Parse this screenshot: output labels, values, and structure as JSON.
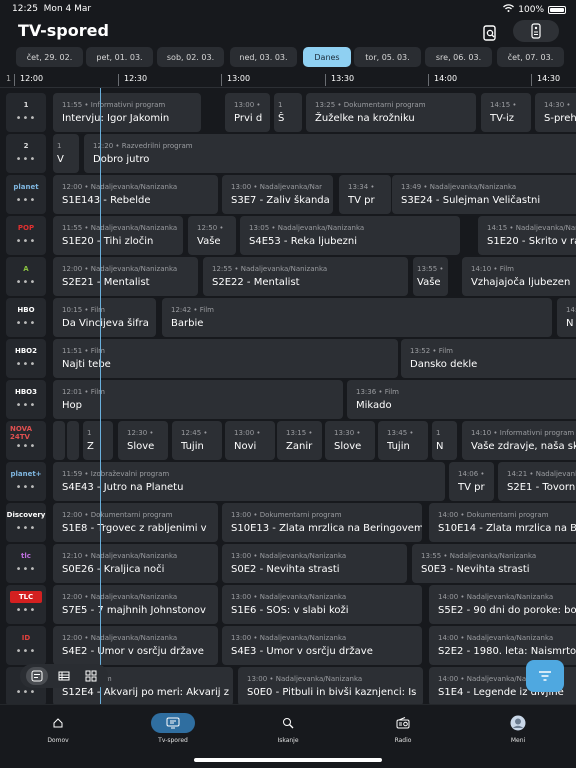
{
  "status": {
    "time": "12:25",
    "date": "Mon 4 Mar",
    "battery": "100%"
  },
  "header": {
    "title": "TV-spored"
  },
  "days": [
    {
      "label": "čet, 29. 02."
    },
    {
      "label": "pet, 01. 03."
    },
    {
      "label": "sob, 02. 03."
    },
    {
      "label": "ned, 03. 03."
    },
    {
      "label": "Danes",
      "active": true
    },
    {
      "label": "tor, 05. 03."
    },
    {
      "label": "sre, 06. 03."
    },
    {
      "label": "čet, 07. 03."
    }
  ],
  "timeline": {
    "lead": "1",
    "ticks": [
      "12:00",
      "12:30",
      "13:00",
      "13:30",
      "14:00",
      "14:30"
    ]
  },
  "channels": [
    {
      "logo": "1",
      "programs": [
        {
          "meta": "11:55 • Informativni program",
          "name": "Intervju: Igor Jakomin"
        },
        {
          "meta": "13:00 •",
          "name": "Prvi d"
        },
        {
          "meta": "1",
          "name": "Š"
        },
        {
          "meta": "13:25 • Dokumentarni program",
          "name": "Žuželke na krožniku"
        },
        {
          "meta": "14:15 •",
          "name": "TV-iz"
        },
        {
          "meta": "14:30 •",
          "name": "S-prehi"
        }
      ]
    },
    {
      "logo": "2",
      "programs": [
        {
          "meta": "1",
          "name": "V"
        },
        {
          "meta": "12:20 • Razvedrilni program",
          "name": "Dobro jutro"
        }
      ]
    },
    {
      "logo": "planet",
      "programs": [
        {
          "meta": "12:00 • Nadaljevanka/Nanizanka",
          "name": "S1E143 - Rebelde"
        },
        {
          "meta": "13:00 • Nadaljevanka/Nar",
          "name": "S3E7 - Zaliv škanda"
        },
        {
          "meta": "13:34 •",
          "name": "TV pr"
        },
        {
          "meta": "13:49 • Nadaljevanka/Nanizanka",
          "name": "S3E24 - Sulejman Veličastni"
        }
      ]
    },
    {
      "logo": "POP",
      "programs": [
        {
          "meta": "11:55 • Nadaljevanka/Nanizanka",
          "name": "S1E20 - Tihi zločin"
        },
        {
          "meta": "12:50 •",
          "name": "Vaše"
        },
        {
          "meta": "13:05 • Nadaljevanka/Nanizanka",
          "name": "S4E53 - Reka ljubezni"
        },
        {
          "meta": "14:15 • Nadaljevanka/Nanizanka",
          "name": "S1E20 - Skrito v ra"
        }
      ]
    },
    {
      "logo": "A",
      "programs": [
        {
          "meta": "12:00 • Nadaljevanka/Nanizanka",
          "name": "S2E21 - Mentalist"
        },
        {
          "meta": "12:55 • Nadaljevanka/Nanizanka",
          "name": "S2E22 - Mentalist"
        },
        {
          "meta": "13:55 •",
          "name": "Vaše"
        },
        {
          "meta": "14:10 • Film",
          "name": "Vzhajajoča ljubezen"
        }
      ]
    },
    {
      "logo": "HBO",
      "programs": [
        {
          "meta": "10:15 • Film",
          "name": "Da Vincijeva šifra"
        },
        {
          "meta": "12:42 • Film",
          "name": "Barbie"
        },
        {
          "meta": "14:",
          "name": "N"
        }
      ]
    },
    {
      "logo": "HBO2",
      "programs": [
        {
          "meta": "11:51 • Film",
          "name": "Najti tebe"
        },
        {
          "meta": "13:52 • Film",
          "name": "Dansko dekle"
        }
      ]
    },
    {
      "logo": "HBO3",
      "programs": [
        {
          "meta": "12:01 • Film",
          "name": "Hop"
        },
        {
          "meta": "13:36 • Film",
          "name": "Mikado"
        }
      ]
    },
    {
      "logo": "NOVA 24TV",
      "programs": [
        {
          "meta": "",
          "name": ""
        },
        {
          "meta": "",
          "name": ""
        },
        {
          "meta": "1",
          "name": "Z"
        },
        {
          "meta": "12:30 •",
          "name": "Slove"
        },
        {
          "meta": "12:45 •",
          "name": "Tujin"
        },
        {
          "meta": "13:00 •",
          "name": "Novi"
        },
        {
          "meta": "13:15 •",
          "name": "Zanir"
        },
        {
          "meta": "13:30 •",
          "name": "Slove"
        },
        {
          "meta": "13:45 •",
          "name": "Tujin"
        },
        {
          "meta": "1",
          "name": "N"
        },
        {
          "meta": "14:10 • Informativni program",
          "name": "Vaše zdravje, naša sk"
        }
      ]
    },
    {
      "logo": "planet+",
      "programs": [
        {
          "meta": "11:59 • Izobraževalni program",
          "name": "S4E43 - Jutro na Planetu"
        },
        {
          "meta": "14:06 •",
          "name": "TV pr"
        },
        {
          "meta": "14:21 • Nadaljevanka/",
          "name": "S2E1 - Tovorn"
        }
      ]
    },
    {
      "logo": "Discovery",
      "programs": [
        {
          "meta": "12:00 • Dokumentarni program",
          "name": "S1E8 - Trgovec z rabljenimi v"
        },
        {
          "meta": "13:00 • Dokumentarni program",
          "name": "S10E13 - Zlata mrzlica na Beringovem"
        },
        {
          "meta": "14:00 • Dokumentarni program",
          "name": "S10E14 - Zlata mrzlica na Be"
        }
      ]
    },
    {
      "logo": "tlc",
      "programs": [
        {
          "meta": "12:10 • Nadaljevanka/Nanizanka",
          "name": "S0E26 - Kraljica noči"
        },
        {
          "meta": "13:00 • Nadaljevanka/Nanizanka",
          "name": "S0E2 - Nevihta strasti"
        },
        {
          "meta": "13:55 • Nadaljevanka/Nanizanka",
          "name": "S0E3 - Nevihta strasti"
        }
      ]
    },
    {
      "logo": "TLC",
      "programs": [
        {
          "meta": "12:00 • Nadaljevanka/Nanizanka",
          "name": "S7E5 - 7 majhnih Johnstonov"
        },
        {
          "meta": "13:00 • Nadaljevanka/Nanizanka",
          "name": "S1E6 - SOS: v slabi koži"
        },
        {
          "meta": "14:00 • Nadaljevanka/Nanizanka",
          "name": "S5E2 - 90 dni do poroke: bos"
        }
      ]
    },
    {
      "logo": "ID",
      "programs": [
        {
          "meta": "12:00 • Nadaljevanka/Nanizanka",
          "name": "S4E2 - Umor v osrčju države"
        },
        {
          "meta": "13:00 • Nadaljevanka/Nanizanka",
          "name": "S4E3 - Umor v osrčju države"
        },
        {
          "meta": "14:00 • Nadaljevanka/Nanizanka",
          "name": "S2E2 - 1980. leta: Naismrton"
        }
      ]
    },
    {
      "logo": "",
      "programs": [
        {
          "meta": "drilni program",
          "name": "S12E4 - Akvarij po meri: Akvarij z"
        },
        {
          "meta": "13:00 • Nadaljevanka/Nanizanka",
          "name": "S0E0 - Pitbuli in bivši kaznjenci: Is"
        },
        {
          "meta": "14:00 • Nadaljevanka/Nanizanka",
          "name": "S1E4 - Legende iz divjine"
        }
      ]
    }
  ],
  "tabs": [
    {
      "label": "Domov",
      "icon": "home-icon"
    },
    {
      "label": "Tv-spored",
      "icon": "tv-guide-icon",
      "active": true
    },
    {
      "label": "Iskanje",
      "icon": "search-icon"
    },
    {
      "label": "Radio",
      "icon": "radio-icon"
    },
    {
      "label": "Meni",
      "icon": "avatar-icon"
    }
  ],
  "colors": {
    "background": "#17191d",
    "card": "#2c2f34",
    "accent": "#8fd0f2",
    "nowline": "#6ab0dc",
    "fab": "#4fa8e0",
    "tab_active": "#2f6ea0"
  }
}
